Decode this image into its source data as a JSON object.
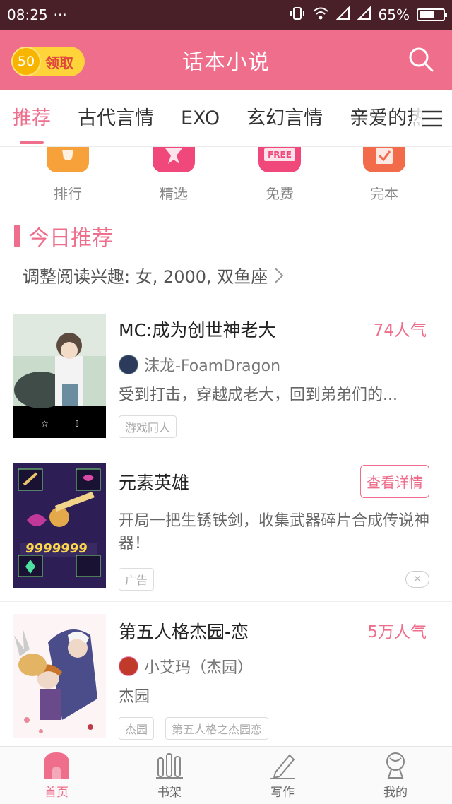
{
  "status_bar": {
    "time": "08:25",
    "more": "···",
    "battery": "65%",
    "battery_level": 0.65
  },
  "header": {
    "coin_amount": "50",
    "coin_label": "领取",
    "title": "话本小说"
  },
  "tabs": [
    {
      "label": "推荐",
      "active": true
    },
    {
      "label": "古代言情"
    },
    {
      "label": "EXO"
    },
    {
      "label": "玄幻言情"
    },
    {
      "label": "亲爱的热"
    }
  ],
  "quick_entries": [
    {
      "label": "排行",
      "icon": "trophy-icon",
      "color": "#f7a13a"
    },
    {
      "label": "精选",
      "icon": "star-icon",
      "color": "#f0487a"
    },
    {
      "label": "免费",
      "icon": "free-icon",
      "color": "#f0487a",
      "badge": "FREE"
    },
    {
      "label": "完本",
      "icon": "check-icon",
      "color": "#f26b4b"
    }
  ],
  "section": {
    "title": "今日推荐",
    "interest_text": "调整阅读兴趣: 女, 2000, 双鱼座"
  },
  "books": [
    {
      "title": "MC:成为创世神老大",
      "popularity": "74人气",
      "author": "沫龙-FoamDragon",
      "description": "受到打击，穿越成老大，回到弟弟们的...",
      "tags": [
        "游戏同人"
      ]
    },
    {
      "title": "元素英雄",
      "detail_button": "查看详情",
      "description": "开局一把生锈铁剑，收集武器碎片合成传说神器！",
      "tags": [
        "广告"
      ],
      "cover_text": "9999999"
    },
    {
      "title": "第五人格杰园-恋",
      "popularity": "5万人气",
      "author": "小艾玛（杰园）",
      "description": "杰园",
      "tags": [
        "杰园",
        "第五人格之杰园恋"
      ]
    }
  ],
  "bottom_nav": [
    {
      "label": "首页",
      "icon": "home-icon",
      "active": true
    },
    {
      "label": "书架",
      "icon": "bookshelf-icon"
    },
    {
      "label": "写作",
      "icon": "pen-icon"
    },
    {
      "label": "我的",
      "icon": "profile-icon"
    }
  ],
  "colors": {
    "accent": "#ee6e8c",
    "status_bar": "#4a2028",
    "coin": "#ffd43b"
  }
}
